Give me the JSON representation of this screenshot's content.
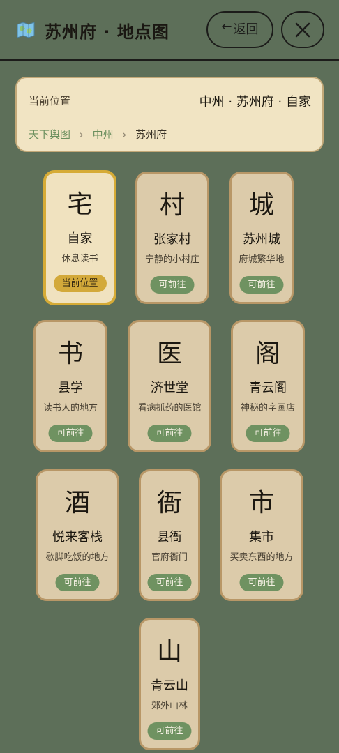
{
  "header": {
    "title": "苏州府 · 地点图",
    "back_label": "返回",
    "back_icon": "left-arrow-icon",
    "close_icon": "close-icon",
    "map_icon": "map-icon"
  },
  "location": {
    "label": "当前位置",
    "value": "中州 · 苏州府 · 自家",
    "breadcrumb": [
      "天下舆图",
      "中州",
      "苏州府"
    ],
    "separator": "›"
  },
  "places": [
    {
      "glyph": "宅",
      "name": "自家",
      "desc": "休息读书",
      "badge": "当前位置",
      "current": true
    },
    {
      "glyph": "村",
      "name": "张家村",
      "desc": "宁静的小村庄",
      "badge": "可前往",
      "current": false
    },
    {
      "glyph": "城",
      "name": "苏州城",
      "desc": "府城繁华地",
      "badge": "可前往",
      "current": false
    },
    {
      "glyph": "书",
      "name": "县学",
      "desc": "读书人的地方",
      "badge": "可前往",
      "current": false
    },
    {
      "glyph": "医",
      "name": "济世堂",
      "desc": "看病抓药的医馆",
      "badge": "可前往",
      "current": false
    },
    {
      "glyph": "阁",
      "name": "青云阁",
      "desc": "神秘的字画店",
      "badge": "可前往",
      "current": false
    },
    {
      "glyph": "酒",
      "name": "悦来客栈",
      "desc": "歇脚吃饭的地方",
      "badge": "可前往",
      "current": false
    },
    {
      "glyph": "衙",
      "name": "县衙",
      "desc": "官府衙门",
      "badge": "可前往",
      "current": false
    },
    {
      "glyph": "市",
      "name": "集市",
      "desc": "买卖东西的地方",
      "badge": "可前往",
      "current": false
    },
    {
      "glyph": "山",
      "name": "青云山",
      "desc": "郊外山林",
      "badge": "可前往",
      "current": false
    }
  ],
  "colors": {
    "background": "#5d6f59",
    "card": "#dccbaa",
    "card_border": "#b89767",
    "current_border": "#d6ab36",
    "badge_green": "#6f9261",
    "badge_gold": "#d3a93a"
  }
}
